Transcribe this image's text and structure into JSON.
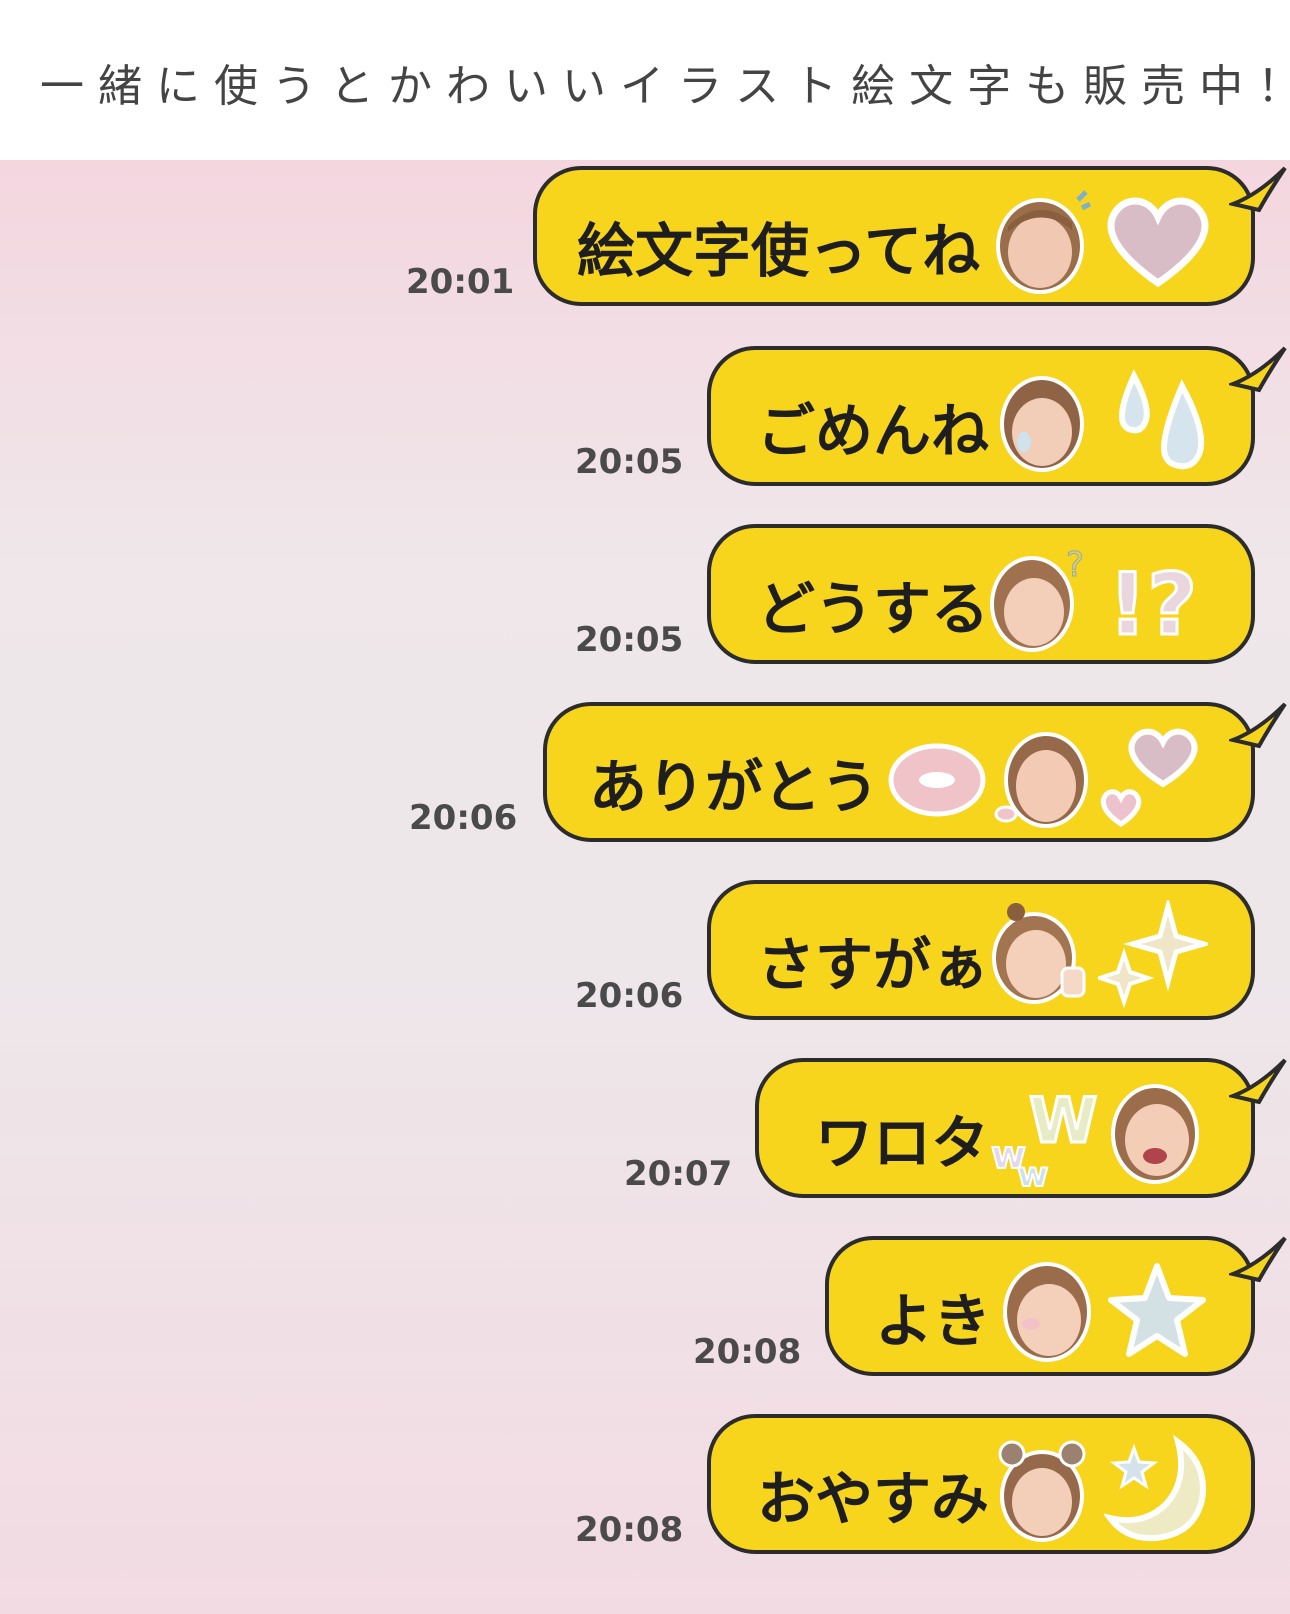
{
  "header": {
    "title": "一緒に使うとかわいいイラスト絵文字も販売中！"
  },
  "colors": {
    "bubble": "#f7d51d",
    "bubble_border": "#2c2c2c",
    "text": "#1e1e1e",
    "time": "#4a4a4a"
  },
  "messages": [
    {
      "text": "絵文字使ってね",
      "time": "20:01",
      "emojis": [
        "child-face-sticker",
        "heart-sticker"
      ]
    },
    {
      "text": "ごめんね",
      "time": "20:05",
      "emojis": [
        "child-face-crying-sticker",
        "tears-sticker"
      ]
    },
    {
      "text": "どうする",
      "time": "20:05",
      "emojis": [
        "child-face-puzzled-sticker",
        "exclamation-question-sticker"
      ]
    },
    {
      "text": "ありがとう",
      "time": "20:06",
      "emojis": [
        "lips-sticker",
        "child-face-kiss-sticker",
        "hearts-sticker"
      ]
    },
    {
      "text": "さすがぁ",
      "time": "20:06",
      "emojis": [
        "child-face-thumbs-up-sticker",
        "sparkles-sticker"
      ]
    },
    {
      "text": "ワロタ",
      "time": "20:07",
      "emojis": [
        "www-sticker",
        "child-face-laughing-sticker"
      ]
    },
    {
      "text": "よき",
      "time": "20:08",
      "emojis": [
        "child-face-smiling-sticker",
        "star-sticker"
      ]
    },
    {
      "text": "おやすみ",
      "time": "20:08",
      "emojis": [
        "child-face-sleepy-sticker",
        "moon-star-sticker"
      ]
    }
  ]
}
